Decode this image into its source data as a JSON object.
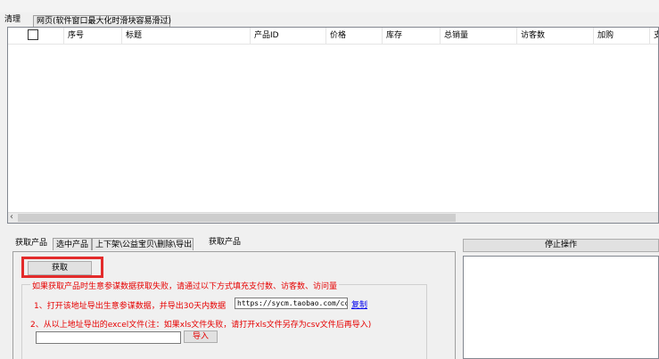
{
  "top_tabs": [
    "清理",
    "网页(软件窗口最大化时滑块容易滑过)"
  ],
  "grid": {
    "columns": [
      "序号",
      "标题",
      "产品ID",
      "价格",
      "库存",
      "总销量",
      "访客数",
      "加购",
      "支"
    ]
  },
  "bottom_tabs": [
    "获取产品",
    "选中产品",
    "上下架\\公益宝贝\\删除\\导出",
    "获取产品"
  ],
  "get_button": "获取",
  "fail_note": "如果获取产品时生意参谋数据获取失败，请通过以下方式填充支付数、访客数、访问量",
  "step1": {
    "text": "1、打开该地址导出生意参谋数据，并导出30天内数据",
    "url": "https://sycm.taobao.com/cc/macro",
    "copy_link": "复制"
  },
  "step2": {
    "text": "2、从以上地址导出的excel文件(注：如果xls文件失败，请打开xls文件另存为csv文件后再导入)"
  },
  "import_button": "导入",
  "stop_button": "停止操作",
  "colors": {
    "accent_red": "#e60000",
    "highlight_border": "#e32b2b",
    "link_blue": "#0000ee"
  }
}
